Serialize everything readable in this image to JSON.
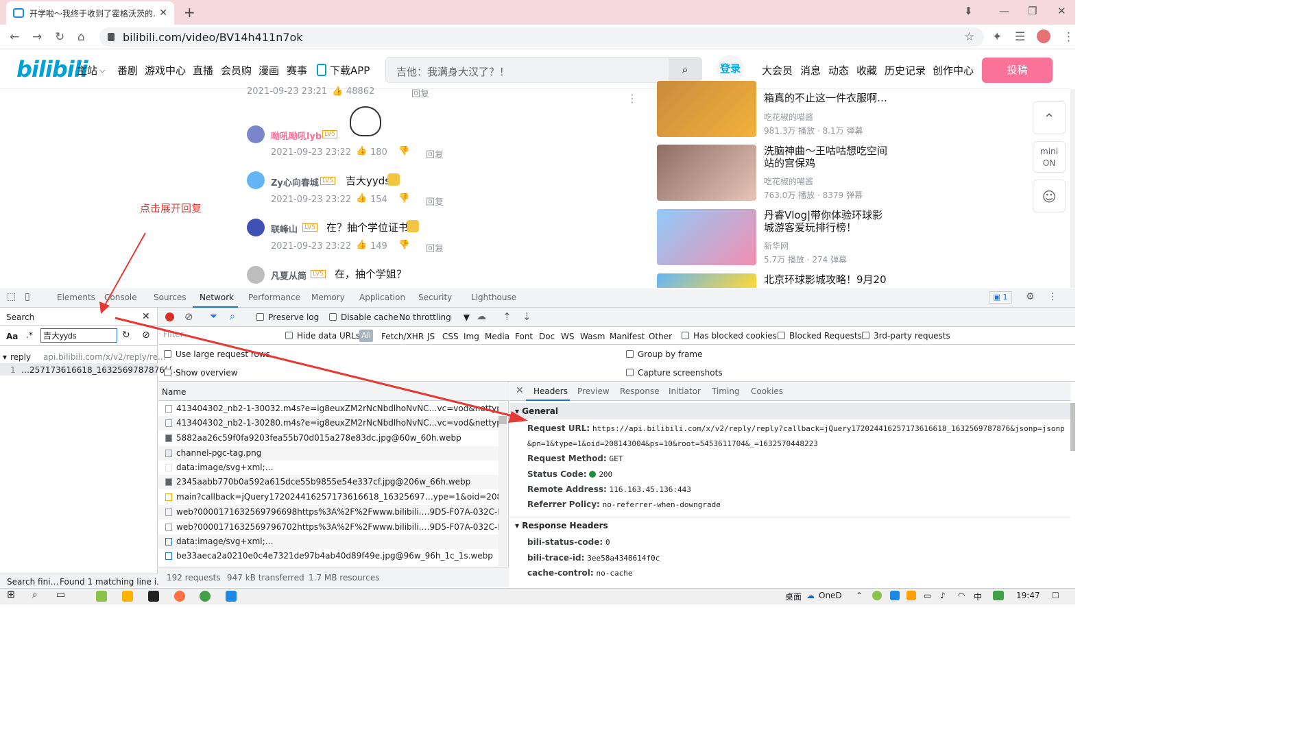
{
  "browser": {
    "tab_title": "开学啦～我终于收到了霍格沃茨的…",
    "new_tab": "+",
    "url": "bilibili.com/video/BV14h411n7ok"
  },
  "site": {
    "logo": "bilibili",
    "nav": [
      "主站",
      "番剧",
      "游戏中心",
      "直播",
      "会员购",
      "漫画",
      "赛事",
      "下载APP"
    ],
    "search_placeholder": "吉他：我满身大汉了？！",
    "login": "登录",
    "user_nav": [
      "大会员",
      "消息",
      "动态",
      "收藏",
      "历史记录",
      "创作中心"
    ],
    "upload": "投稿"
  },
  "comments": [
    {
      "meta_time": "2021-09-23 23:21",
      "likes": "48862",
      "reply": "回复"
    },
    {
      "user": "呦吼呦吼lyb",
      "text": "",
      "time": "2021-09-23 23:22",
      "likes": "180",
      "reply": "回复"
    },
    {
      "user": "Zy心向春城",
      "text": "吉大yyds",
      "time": "2021-09-23 23:22",
      "likes": "154",
      "reply": "回复"
    },
    {
      "user": "联峰山",
      "text": "在？抽个学位证书",
      "time": "2021-09-23 23:22",
      "likes": "149",
      "reply": "回复"
    },
    {
      "user": "凡夏从简",
      "text": "在，抽个学姐？",
      "time": "",
      "likes": "",
      "reply": ""
    }
  ],
  "level_badge": "LV5",
  "annotation": "点击展开回复",
  "recommend": [
    {
      "title1": "箱真的不止这一件衣服啊…",
      "title2": "",
      "up": "吃花椒的喵酱",
      "stats": "981.3万 播放 · 8.1万 弹幕"
    },
    {
      "title1": "洗脑神曲～王咕咕想吃空间",
      "title2": "站的宫保鸡",
      "up": "吃花椒的喵酱",
      "stats": "763.0万 播放 · 8379 弹幕"
    },
    {
      "title1": "丹睿Vlog|带你体验环球影",
      "title2": "城游客爱玩排行榜！",
      "up": "新华网",
      "stats": "5.7万 播放 · 274 弹幕"
    },
    {
      "title1": "北京环球影城攻略！9月20",
      "title2": "",
      "up": "",
      "stats": ""
    }
  ],
  "side": {
    "mini": "mini",
    "on": "ON"
  },
  "devtools": {
    "tabs": [
      "Elements",
      "Console",
      "Sources",
      "Network",
      "Performance",
      "Memory",
      "Application",
      "Security",
      "Lighthouse"
    ],
    "issues": "1",
    "search_title": "Search",
    "search_value": "吉大yyds",
    "aa": "Aa",
    "regex": ".*",
    "result_file": "reply",
    "result_url": "api.bilibili.com/x/v2/reply/re...",
    "result_line_no": "1",
    "result_line": "…257173616618_1632569787876({…",
    "search_status_left": "Search fini…",
    "search_status_right": "Found 1 matching line i…",
    "preserve_log": "Preserve log",
    "disable_cache": "Disable cache",
    "throttling": "No throttling",
    "filter_placeholder": "Filter",
    "hide_data_urls": "Hide data URLs",
    "types": [
      "All",
      "Fetch/XHR",
      "JS",
      "CSS",
      "Img",
      "Media",
      "Font",
      "Doc",
      "WS",
      "Wasm",
      "Manifest",
      "Other"
    ],
    "has_blocked": "Has blocked cookies",
    "blocked_requests": "Blocked Requests",
    "third_party": "3rd-party requests",
    "large_rows": "Use large request rows",
    "show_overview": "Show overview",
    "group_by_frame": "Group by frame",
    "capture_screenshots": "Capture screenshots",
    "name_header": "Name",
    "requests": [
      "413404302_nb2-1-30032.m4s?e=ig8euxZM2rNcNbdlhoNvNC…vc=vod&nettype=0&o",
      "413404302_nb2-1-30280.m4s?e=ig8euxZM2rNcNbdlhoNvNC…vc=vod&nettype=0&o",
      "5882aa26c59f0fa9203fea55b70d015a278e83dc.jpg@60w_60h.webp",
      "channel-pgc-tag.png",
      "data:image/svg+xml;…",
      "2345aabb770b0a592a615dce55b9855e54e337cf.jpg@206w_66h.webp",
      "main?callback=jQuery17202441625717361661​8_16325697…ype=1&oid=208143004&",
      "web?0000171632569796698https%3A%2F%2Fwww.bilibili.…9D5-F07A-032C-F6EF1635",
      "web?0000171632569796702https%3A%2F%2Fwww.bilibili.…9D5-F07A-032C-F6EF1635",
      "data:image/svg+xml;…",
      "be33aeca2a0210e0c4e7321de97b4ab40d89f49e.jpg@96w_96h_1c_1s.webp"
    ],
    "status": [
      "192 requests",
      "947 kB transferred",
      "1.7 MB resources"
    ],
    "detail_tabs": [
      "Headers",
      "Preview",
      "Response",
      "Initiator",
      "Timing",
      "Cookies"
    ],
    "general_title": "General",
    "request_url_label": "Request URL:",
    "request_url_1": "https://api.bilibili.com/x/v2/reply/reply?callback=jQuery17202441625717361661​8_1632569787876&jsonp=jsonp",
    "request_url_2": "&pn=1&type=1&oid=208143004&ps=10&root=5453611704&_=1632570448223",
    "request_method_label": "Request Method:",
    "request_method": "GET",
    "status_code_label": "Status Code:",
    "status_code": "200",
    "remote_address_label": "Remote Address:",
    "remote_address": "116.163.45.136:443",
    "referrer_policy_label": "Referrer Policy:",
    "referrer_policy": "no-referrer-when-downgrade",
    "response_headers_title": "Response Headers",
    "resp": [
      {
        "k": "bili-status-code:",
        "v": "0"
      },
      {
        "k": "bili-trace-id:",
        "v": "3ee58a4348614f0c"
      },
      {
        "k": "cache-control:",
        "v": "no-cache"
      }
    ]
  },
  "taskbar": {
    "desktop": "桌面",
    "onedrive": "OneD",
    "time": "19:47"
  },
  "colors": {
    "accent": "#1a73e8",
    "bili_blue": "#00a1d6",
    "bili_pink": "#fb7299",
    "annotation": "#e53935"
  }
}
